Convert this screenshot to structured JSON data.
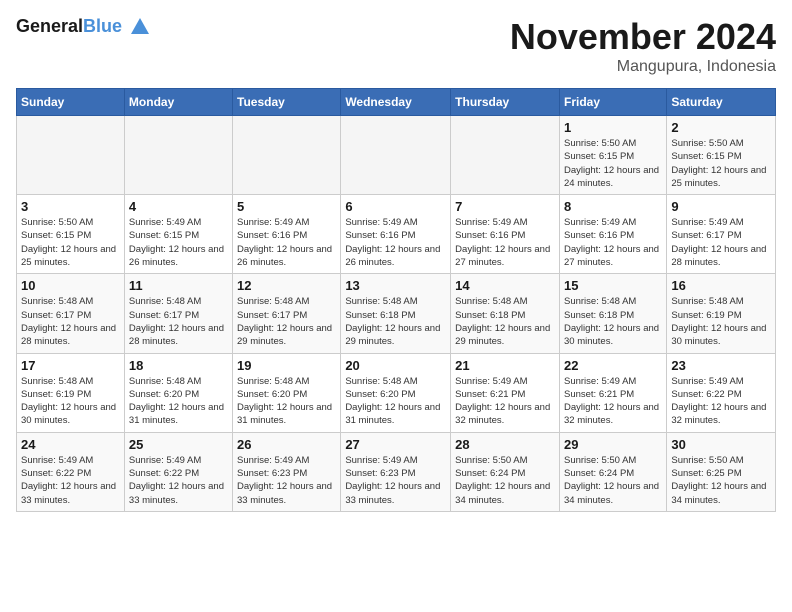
{
  "header": {
    "logo_line1": "General",
    "logo_line2": "Blue",
    "month_title": "November 2024",
    "location": "Mangupura, Indonesia"
  },
  "weekdays": [
    "Sunday",
    "Monday",
    "Tuesday",
    "Wednesday",
    "Thursday",
    "Friday",
    "Saturday"
  ],
  "weeks": [
    [
      {
        "day": "",
        "info": ""
      },
      {
        "day": "",
        "info": ""
      },
      {
        "day": "",
        "info": ""
      },
      {
        "day": "",
        "info": ""
      },
      {
        "day": "",
        "info": ""
      },
      {
        "day": "1",
        "info": "Sunrise: 5:50 AM\nSunset: 6:15 PM\nDaylight: 12 hours and 24 minutes."
      },
      {
        "day": "2",
        "info": "Sunrise: 5:50 AM\nSunset: 6:15 PM\nDaylight: 12 hours and 25 minutes."
      }
    ],
    [
      {
        "day": "3",
        "info": "Sunrise: 5:50 AM\nSunset: 6:15 PM\nDaylight: 12 hours and 25 minutes."
      },
      {
        "day": "4",
        "info": "Sunrise: 5:49 AM\nSunset: 6:15 PM\nDaylight: 12 hours and 26 minutes."
      },
      {
        "day": "5",
        "info": "Sunrise: 5:49 AM\nSunset: 6:16 PM\nDaylight: 12 hours and 26 minutes."
      },
      {
        "day": "6",
        "info": "Sunrise: 5:49 AM\nSunset: 6:16 PM\nDaylight: 12 hours and 26 minutes."
      },
      {
        "day": "7",
        "info": "Sunrise: 5:49 AM\nSunset: 6:16 PM\nDaylight: 12 hours and 27 minutes."
      },
      {
        "day": "8",
        "info": "Sunrise: 5:49 AM\nSunset: 6:16 PM\nDaylight: 12 hours and 27 minutes."
      },
      {
        "day": "9",
        "info": "Sunrise: 5:49 AM\nSunset: 6:17 PM\nDaylight: 12 hours and 28 minutes."
      }
    ],
    [
      {
        "day": "10",
        "info": "Sunrise: 5:48 AM\nSunset: 6:17 PM\nDaylight: 12 hours and 28 minutes."
      },
      {
        "day": "11",
        "info": "Sunrise: 5:48 AM\nSunset: 6:17 PM\nDaylight: 12 hours and 28 minutes."
      },
      {
        "day": "12",
        "info": "Sunrise: 5:48 AM\nSunset: 6:17 PM\nDaylight: 12 hours and 29 minutes."
      },
      {
        "day": "13",
        "info": "Sunrise: 5:48 AM\nSunset: 6:18 PM\nDaylight: 12 hours and 29 minutes."
      },
      {
        "day": "14",
        "info": "Sunrise: 5:48 AM\nSunset: 6:18 PM\nDaylight: 12 hours and 29 minutes."
      },
      {
        "day": "15",
        "info": "Sunrise: 5:48 AM\nSunset: 6:18 PM\nDaylight: 12 hours and 30 minutes."
      },
      {
        "day": "16",
        "info": "Sunrise: 5:48 AM\nSunset: 6:19 PM\nDaylight: 12 hours and 30 minutes."
      }
    ],
    [
      {
        "day": "17",
        "info": "Sunrise: 5:48 AM\nSunset: 6:19 PM\nDaylight: 12 hours and 30 minutes."
      },
      {
        "day": "18",
        "info": "Sunrise: 5:48 AM\nSunset: 6:20 PM\nDaylight: 12 hours and 31 minutes."
      },
      {
        "day": "19",
        "info": "Sunrise: 5:48 AM\nSunset: 6:20 PM\nDaylight: 12 hours and 31 minutes."
      },
      {
        "day": "20",
        "info": "Sunrise: 5:48 AM\nSunset: 6:20 PM\nDaylight: 12 hours and 31 minutes."
      },
      {
        "day": "21",
        "info": "Sunrise: 5:49 AM\nSunset: 6:21 PM\nDaylight: 12 hours and 32 minutes."
      },
      {
        "day": "22",
        "info": "Sunrise: 5:49 AM\nSunset: 6:21 PM\nDaylight: 12 hours and 32 minutes."
      },
      {
        "day": "23",
        "info": "Sunrise: 5:49 AM\nSunset: 6:22 PM\nDaylight: 12 hours and 32 minutes."
      }
    ],
    [
      {
        "day": "24",
        "info": "Sunrise: 5:49 AM\nSunset: 6:22 PM\nDaylight: 12 hours and 33 minutes."
      },
      {
        "day": "25",
        "info": "Sunrise: 5:49 AM\nSunset: 6:22 PM\nDaylight: 12 hours and 33 minutes."
      },
      {
        "day": "26",
        "info": "Sunrise: 5:49 AM\nSunset: 6:23 PM\nDaylight: 12 hours and 33 minutes."
      },
      {
        "day": "27",
        "info": "Sunrise: 5:49 AM\nSunset: 6:23 PM\nDaylight: 12 hours and 33 minutes."
      },
      {
        "day": "28",
        "info": "Sunrise: 5:50 AM\nSunset: 6:24 PM\nDaylight: 12 hours and 34 minutes."
      },
      {
        "day": "29",
        "info": "Sunrise: 5:50 AM\nSunset: 6:24 PM\nDaylight: 12 hours and 34 minutes."
      },
      {
        "day": "30",
        "info": "Sunrise: 5:50 AM\nSunset: 6:25 PM\nDaylight: 12 hours and 34 minutes."
      }
    ]
  ]
}
